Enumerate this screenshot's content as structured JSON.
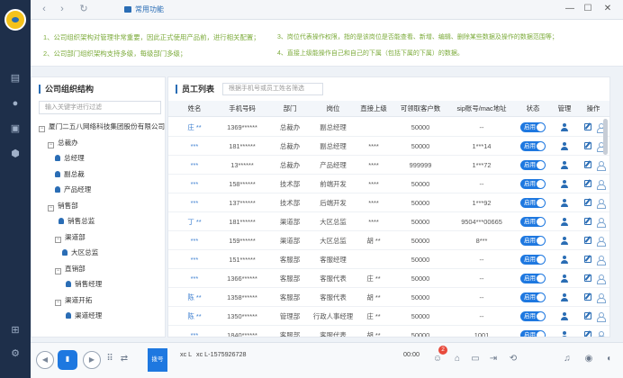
{
  "titlebar": {
    "tab_label": "常用功能"
  },
  "notice": {
    "tips": [
      "1、公司组织架构对管理非常重要，因此正式使用产品前，进行相关配置；",
      "2、公司部门组织架构支持多级，每级部门多级；",
      "3、岗位代表操作权限，指的是该岗位是否能查看、新增、编辑、删除某些数据及操作的数据范围等；",
      "4、直接上级能操作自己和自己的下属（包括下属的下属）的数据。"
    ]
  },
  "org": {
    "title": "公司组织结构",
    "search_placeholder": "输入关键字进行过滤",
    "tree": [
      {
        "label": "厦门二五八网络科技集团股份有限公司",
        "kind": "toggle",
        "symbol": "−"
      },
      {
        "label": "总裁办",
        "kind": "toggle",
        "symbol": "−"
      },
      {
        "label": "总经理",
        "kind": "position"
      },
      {
        "label": "副总裁",
        "kind": "position"
      },
      {
        "label": "产品经理",
        "kind": "position"
      },
      {
        "label": "销售部",
        "kind": "toggle",
        "symbol": "−"
      },
      {
        "label": "销售总监",
        "kind": "position"
      },
      {
        "label": "渠道部",
        "kind": "toggle",
        "symbol": "−"
      },
      {
        "label": "大区总监",
        "kind": "position"
      },
      {
        "label": "直销部",
        "kind": "toggle",
        "symbol": "−"
      },
      {
        "label": "销售经理",
        "kind": "position"
      },
      {
        "label": "渠道开拓",
        "kind": "toggle",
        "symbol": "−"
      },
      {
        "label": "渠道经理",
        "kind": "position"
      }
    ]
  },
  "staff": {
    "title": "员工列表",
    "search_placeholder": "根据手机号或员工姓名筛选",
    "columns": [
      "姓名",
      "手机号码",
      "部门",
      "岗位",
      "直接上级",
      "可领取客户数",
      "sip账号/mac地址",
      "状态",
      "管理",
      "操作"
    ],
    "toggle_label": "启用",
    "rows": [
      {
        "name": "庄 **",
        "phone": "1369******",
        "dept": "总裁办",
        "post": "副总经理",
        "boss": "",
        "quota": "50000",
        "sip": "--"
      },
      {
        "name": "***",
        "phone": "181******",
        "dept": "总裁办",
        "post": "副总经理",
        "boss": "****",
        "quota": "50000",
        "sip": "1***14"
      },
      {
        "name": "***",
        "phone": "13******",
        "dept": "总裁办",
        "post": "产品经理",
        "boss": "****",
        "quota": "999999",
        "sip": "1***72"
      },
      {
        "name": "***",
        "phone": "158******",
        "dept": "技术部",
        "post": "前端开发",
        "boss": "****",
        "quota": "50000",
        "sip": "--"
      },
      {
        "name": "***",
        "phone": "137******",
        "dept": "技术部",
        "post": "后端开发",
        "boss": "****",
        "quota": "50000",
        "sip": "1***92"
      },
      {
        "name": "丁 **",
        "phone": "181******",
        "dept": "渠道部",
        "post": "大区总监",
        "boss": "****",
        "quota": "50000",
        "sip": "9504***00665"
      },
      {
        "name": "***",
        "phone": "159******",
        "dept": "渠道部",
        "post": "大区总监",
        "boss": "胡 **",
        "quota": "50000",
        "sip": "8***"
      },
      {
        "name": "***",
        "phone": "151******",
        "dept": "客服部",
        "post": "客服经理",
        "boss": "",
        "quota": "50000",
        "sip": "--"
      },
      {
        "name": "***",
        "phone": "1366******",
        "dept": "客服部",
        "post": "客服代表",
        "boss": "庄 **",
        "quota": "50000",
        "sip": "--"
      },
      {
        "name": "陈 **",
        "phone": "1358******",
        "dept": "客服部",
        "post": "客服代表",
        "boss": "胡 **",
        "quota": "50000",
        "sip": "--"
      },
      {
        "name": "陈 **",
        "phone": "1350******",
        "dept": "管理部",
        "post": "行政人事经理",
        "boss": "庄 **",
        "quota": "50000",
        "sip": "--"
      },
      {
        "name": "***",
        "phone": "1840******",
        "dept": "客服部",
        "post": "客服代表",
        "boss": "胡 **",
        "quota": "50000",
        "sip": "1001"
      }
    ]
  },
  "bottombar": {
    "call_label": "拨号",
    "line_label": "xc L",
    "line_number": "xc L-1575926728",
    "timer": "00:00",
    "badge_count": "2"
  }
}
